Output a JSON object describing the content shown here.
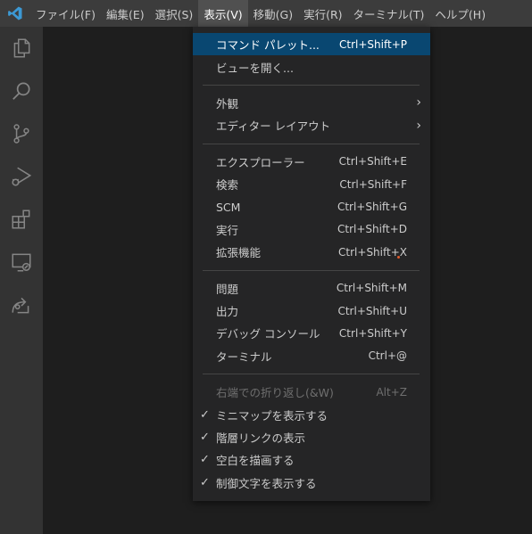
{
  "menubar": {
    "items": [
      "ファイル(F)",
      "編集(E)",
      "選択(S)",
      "表示(V)",
      "移動(G)",
      "実行(R)",
      "ターミナル(T)",
      "ヘルプ(H)"
    ],
    "active_index": 3
  },
  "activitybar": {
    "icons": [
      "explorer-icon",
      "search-icon",
      "source-control-icon",
      "run-debug-icon",
      "extensions-icon",
      "remote-explorer-icon",
      "live-share-icon"
    ]
  },
  "view_menu": {
    "group1": [
      {
        "label": "コマンド パレット...",
        "shortcut": "Ctrl+Shift+P",
        "highlight": true
      },
      {
        "label": "ビューを開く...",
        "shortcut": ""
      }
    ],
    "group2": [
      {
        "label": "外観",
        "submenu": true
      },
      {
        "label": "エディター レイアウト",
        "submenu": true
      }
    ],
    "group3": [
      {
        "label": "エクスプローラー",
        "shortcut": "Ctrl+Shift+E"
      },
      {
        "label": "検索",
        "shortcut": "Ctrl+Shift+F"
      },
      {
        "label": "SCM",
        "shortcut": "Ctrl+Shift+G"
      },
      {
        "label": "実行",
        "shortcut": "Ctrl+Shift+D"
      },
      {
        "label": "拡張機能",
        "shortcut": "Ctrl+Shift+X"
      }
    ],
    "group4": [
      {
        "label": "問題",
        "shortcut": "Ctrl+Shift+M"
      },
      {
        "label": "出力",
        "shortcut": "Ctrl+Shift+U"
      },
      {
        "label": "デバッグ コンソール",
        "shortcut": "Ctrl+Shift+Y"
      },
      {
        "label": "ターミナル",
        "shortcut": "Ctrl+@"
      }
    ],
    "group5": [
      {
        "label": "右端での折り返し(&W)",
        "shortcut": "Alt+Z",
        "disabled": true
      },
      {
        "label": "ミニマップを表示する",
        "checked": true
      },
      {
        "label": "階層リンクの表示",
        "checked": true
      },
      {
        "label": "空白を描画する",
        "checked": true
      },
      {
        "label": "制御文字を表示する",
        "checked": true
      }
    ],
    "check_glyph": "✓",
    "submenu_glyph": "›"
  },
  "colors": {
    "accent": "#094771",
    "logo": "#3c99d4",
    "badge_dot": "#e05a2a"
  }
}
